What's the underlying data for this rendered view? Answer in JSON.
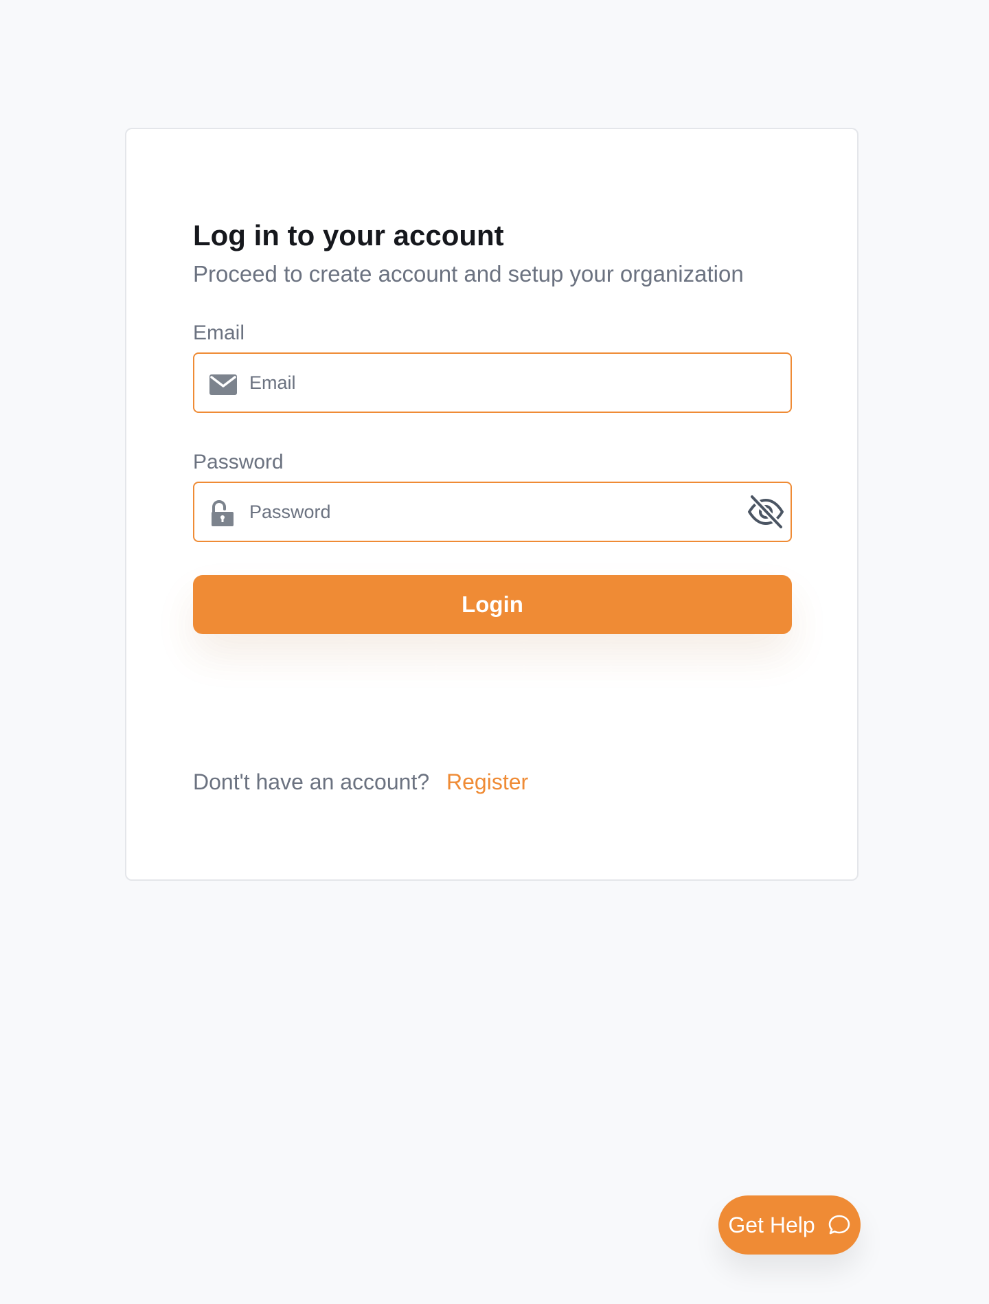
{
  "login": {
    "title": "Log in to your account",
    "subtitle": "Proceed to create account and setup your organization",
    "email": {
      "label": "Email",
      "placeholder": "Email",
      "value": "",
      "icon": "mail-icon"
    },
    "password": {
      "label": "Password",
      "placeholder": "Password",
      "value": "",
      "icon": "lock-open-icon",
      "toggle_icon": "eye-off-icon"
    },
    "submit_label": "Login",
    "register_prompt": "Dont't have an account?",
    "register_link": "Register"
  },
  "help": {
    "label": "Get Help",
    "icon": "chat-bubble-icon"
  },
  "colors": {
    "accent": "#ef8b35",
    "background": "#f8f9fb",
    "card": "#ffffff",
    "text_primary": "#16181d",
    "text_secondary": "#6b7280",
    "icon_gray": "#7c838d"
  }
}
